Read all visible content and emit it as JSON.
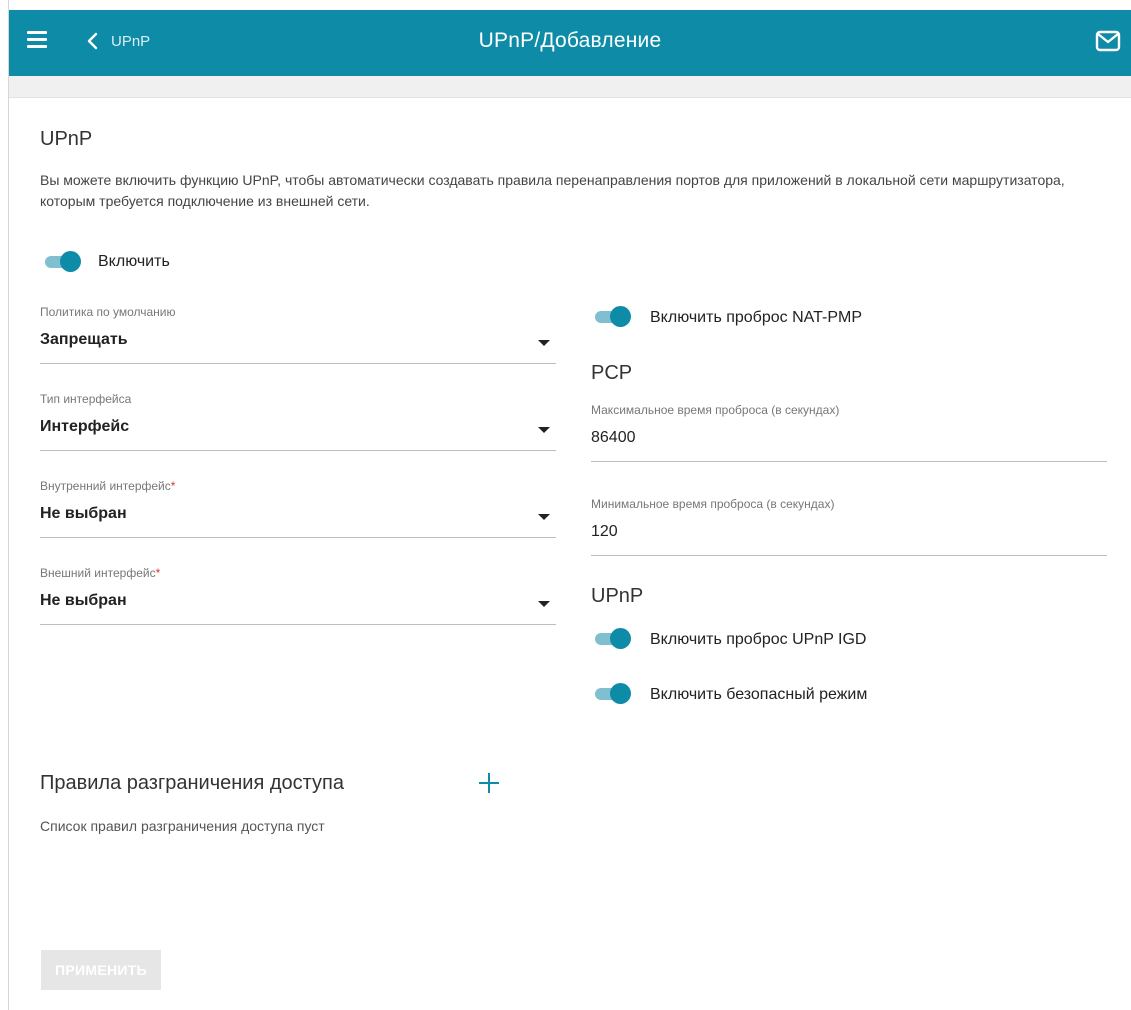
{
  "header": {
    "title": "UPnP/Добавление",
    "back_label": "UPnP",
    "icons": {
      "menu": "hamburger-menu-icon",
      "back": "chevron-left-icon",
      "mail": "mail-icon"
    },
    "color": "#0e8ba7"
  },
  "upnp_section": {
    "title": "UPnP",
    "description": "Вы можете включить функцию UPnP, чтобы автоматически создавать правила перенаправления портов для приложений в локальной сети маршрутизатора, которым требуется подключение из внешней сети.",
    "enable_toggle": {
      "label": "Включить",
      "on": true
    }
  },
  "left_fields": {
    "default_policy": {
      "label": "Политика по умолчанию",
      "value": "Запрещать"
    },
    "interface_type": {
      "label": "Тип интерфейса",
      "value": "Интерфейс"
    },
    "internal_interface": {
      "label": "Внутренний интерфейс",
      "required_mark": "*",
      "value": "Не выбран"
    },
    "external_interface": {
      "label": "Внешний интерфейс",
      "required_mark": "*",
      "value": "Не выбран"
    }
  },
  "right_panel": {
    "nat_pmp_toggle": {
      "label": "Включить проброс NAT-PMP",
      "on": true
    },
    "pcp": {
      "title": "PCP",
      "max_time": {
        "label": "Максимальное время проброса (в секундах)",
        "value": "86400"
      },
      "min_time": {
        "label": "Минимальное время проброса (в секундах)",
        "value": "120"
      }
    },
    "upnp": {
      "title": "UPnP",
      "igd_toggle": {
        "label": "Включить проброс UPnP IGD",
        "on": true
      },
      "secure_toggle": {
        "label": "Включить безопасный режим",
        "on": true
      }
    }
  },
  "access_rules": {
    "title": "Правила разграничения доступа",
    "empty_note": "Список правил разграничения доступа пуст",
    "add_icon": "plus-icon"
  },
  "apply_button": {
    "label": "ПРИМЕНИТЬ",
    "enabled": false
  }
}
